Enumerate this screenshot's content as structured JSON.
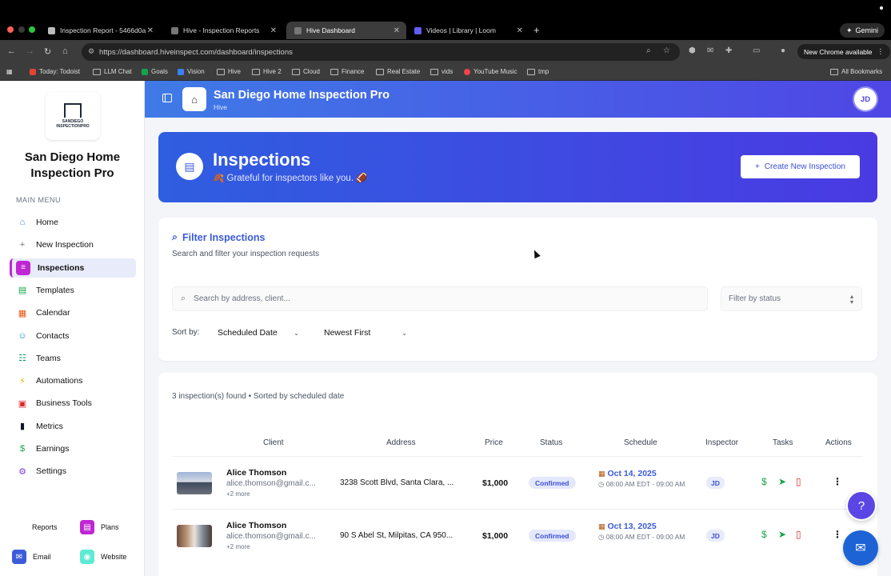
{
  "browser": {
    "tabs": [
      {
        "title": "Inspection Report - 5466d0a",
        "active": false
      },
      {
        "title": "Hive - Inspection Reports",
        "active": false
      },
      {
        "title": "Hive Dashboard",
        "active": true
      },
      {
        "title": "Videos | Library | Loom",
        "active": false
      }
    ],
    "url": "https://dashboard.hiveinspect.com/dashboard/inspections",
    "gemini_label": "Gemini",
    "new_chrome_label": "New Chrome available",
    "bookmarks": [
      "Today: Todoist",
      "LLM Chat",
      "Goals",
      "Vision",
      "Hive",
      "Hive 2",
      "Cloud",
      "Finance",
      "Real Estate",
      "vids",
      "YouTube Music",
      "tmp"
    ],
    "all_bookmarks": "All Bookmarks"
  },
  "sidebar": {
    "logo_line1": "SANDIEGO",
    "logo_line2": "INSPECTIONPRO",
    "company_name": "San Diego Home Inspection Pro",
    "section_label": "MAIN MENU",
    "items": [
      {
        "label": "Home",
        "icon": "home-icon",
        "glyph": "⌂",
        "color": "#3b82f6"
      },
      {
        "label": "New Inspection",
        "icon": "plus-icon",
        "glyph": "+",
        "color": "#6b7280"
      },
      {
        "label": "Inspections",
        "icon": "document-icon",
        "glyph": "≡",
        "color": "#c026d3"
      },
      {
        "label": "Templates",
        "icon": "template-icon",
        "glyph": "▤",
        "color": "#16a34a"
      },
      {
        "label": "Calendar",
        "icon": "calendar-icon",
        "glyph": "▦",
        "color": "#ea580c"
      },
      {
        "label": "Contacts",
        "icon": "contacts-icon",
        "glyph": "☺",
        "color": "#0891b2"
      },
      {
        "label": "Teams",
        "icon": "teams-icon",
        "glyph": "☷",
        "color": "#059669"
      },
      {
        "label": "Automations",
        "icon": "lightning-icon",
        "glyph": "⚡",
        "color": "#eab308"
      },
      {
        "label": "Business Tools",
        "icon": "briefcase-icon",
        "glyph": "▣",
        "color": "#dc2626"
      },
      {
        "label": "Metrics",
        "icon": "bar-chart-icon",
        "glyph": "▮",
        "color": "#111827"
      },
      {
        "label": "Earnings",
        "icon": "dollar-icon",
        "glyph": "$",
        "color": "#16a34a"
      },
      {
        "label": "Settings",
        "icon": "gear-icon",
        "glyph": "⚙",
        "color": "#7c3aed"
      }
    ],
    "bottom_links": [
      {
        "label": "Reports",
        "icon": "reports-icon"
      },
      {
        "label": "Plans",
        "icon": "plans-icon",
        "color": "#c026d3"
      },
      {
        "label": "Email",
        "icon": "email-icon",
        "color": "#3b5bdb"
      },
      {
        "label": "Website",
        "icon": "website-icon",
        "color": "#5eead4"
      }
    ]
  },
  "header": {
    "title": "San Diego Home Inspection Pro",
    "subtitle": "Hive",
    "avatar_initials": "JD"
  },
  "hero": {
    "title": "Inspections",
    "subtitle": "🍂 Grateful for inspectors like you. 🏈",
    "create_button": "Create New Inspection"
  },
  "filter": {
    "title": "Filter Inspections",
    "subtitle": "Search and filter your inspection requests",
    "search_placeholder": "Search by address, client...",
    "status_placeholder": "Filter by status",
    "sort_label": "Sort by:",
    "sort_field": "Scheduled Date",
    "sort_order": "Newest First"
  },
  "table": {
    "summary": "3 inspection(s) found • Sorted by scheduled date",
    "columns": [
      "Client",
      "Address",
      "Price",
      "Status",
      "Schedule",
      "Inspector",
      "Tasks",
      "Actions"
    ],
    "rows": [
      {
        "client": "Alice Thomson",
        "email": "alice.thomson@gmail.c...",
        "more": "+2 more",
        "address": "3238 Scott Blvd, Santa Clara, ...",
        "price": "$1,000",
        "status": "Confirmed",
        "date": "Oct 14, 2025",
        "time": "08:00 AM EDT - 09:00 AM",
        "inspector": "JD"
      },
      {
        "client": "Alice Thomson",
        "email": "alice.thomson@gmail.c...",
        "more": "+2 more",
        "address": "90 S Abel St, Milpitas, CA 950...",
        "price": "$1,000",
        "status": "Confirmed",
        "date": "Oct 13, 2025",
        "time": "08:00 AM EDT - 09:00 AM",
        "inspector": "JD"
      }
    ]
  },
  "colors": {
    "brand": "#3b5bdb",
    "header_gradient_start": "#3f7ae6",
    "header_gradient_end": "#4f46e5",
    "active_accent": "#c026d3"
  }
}
